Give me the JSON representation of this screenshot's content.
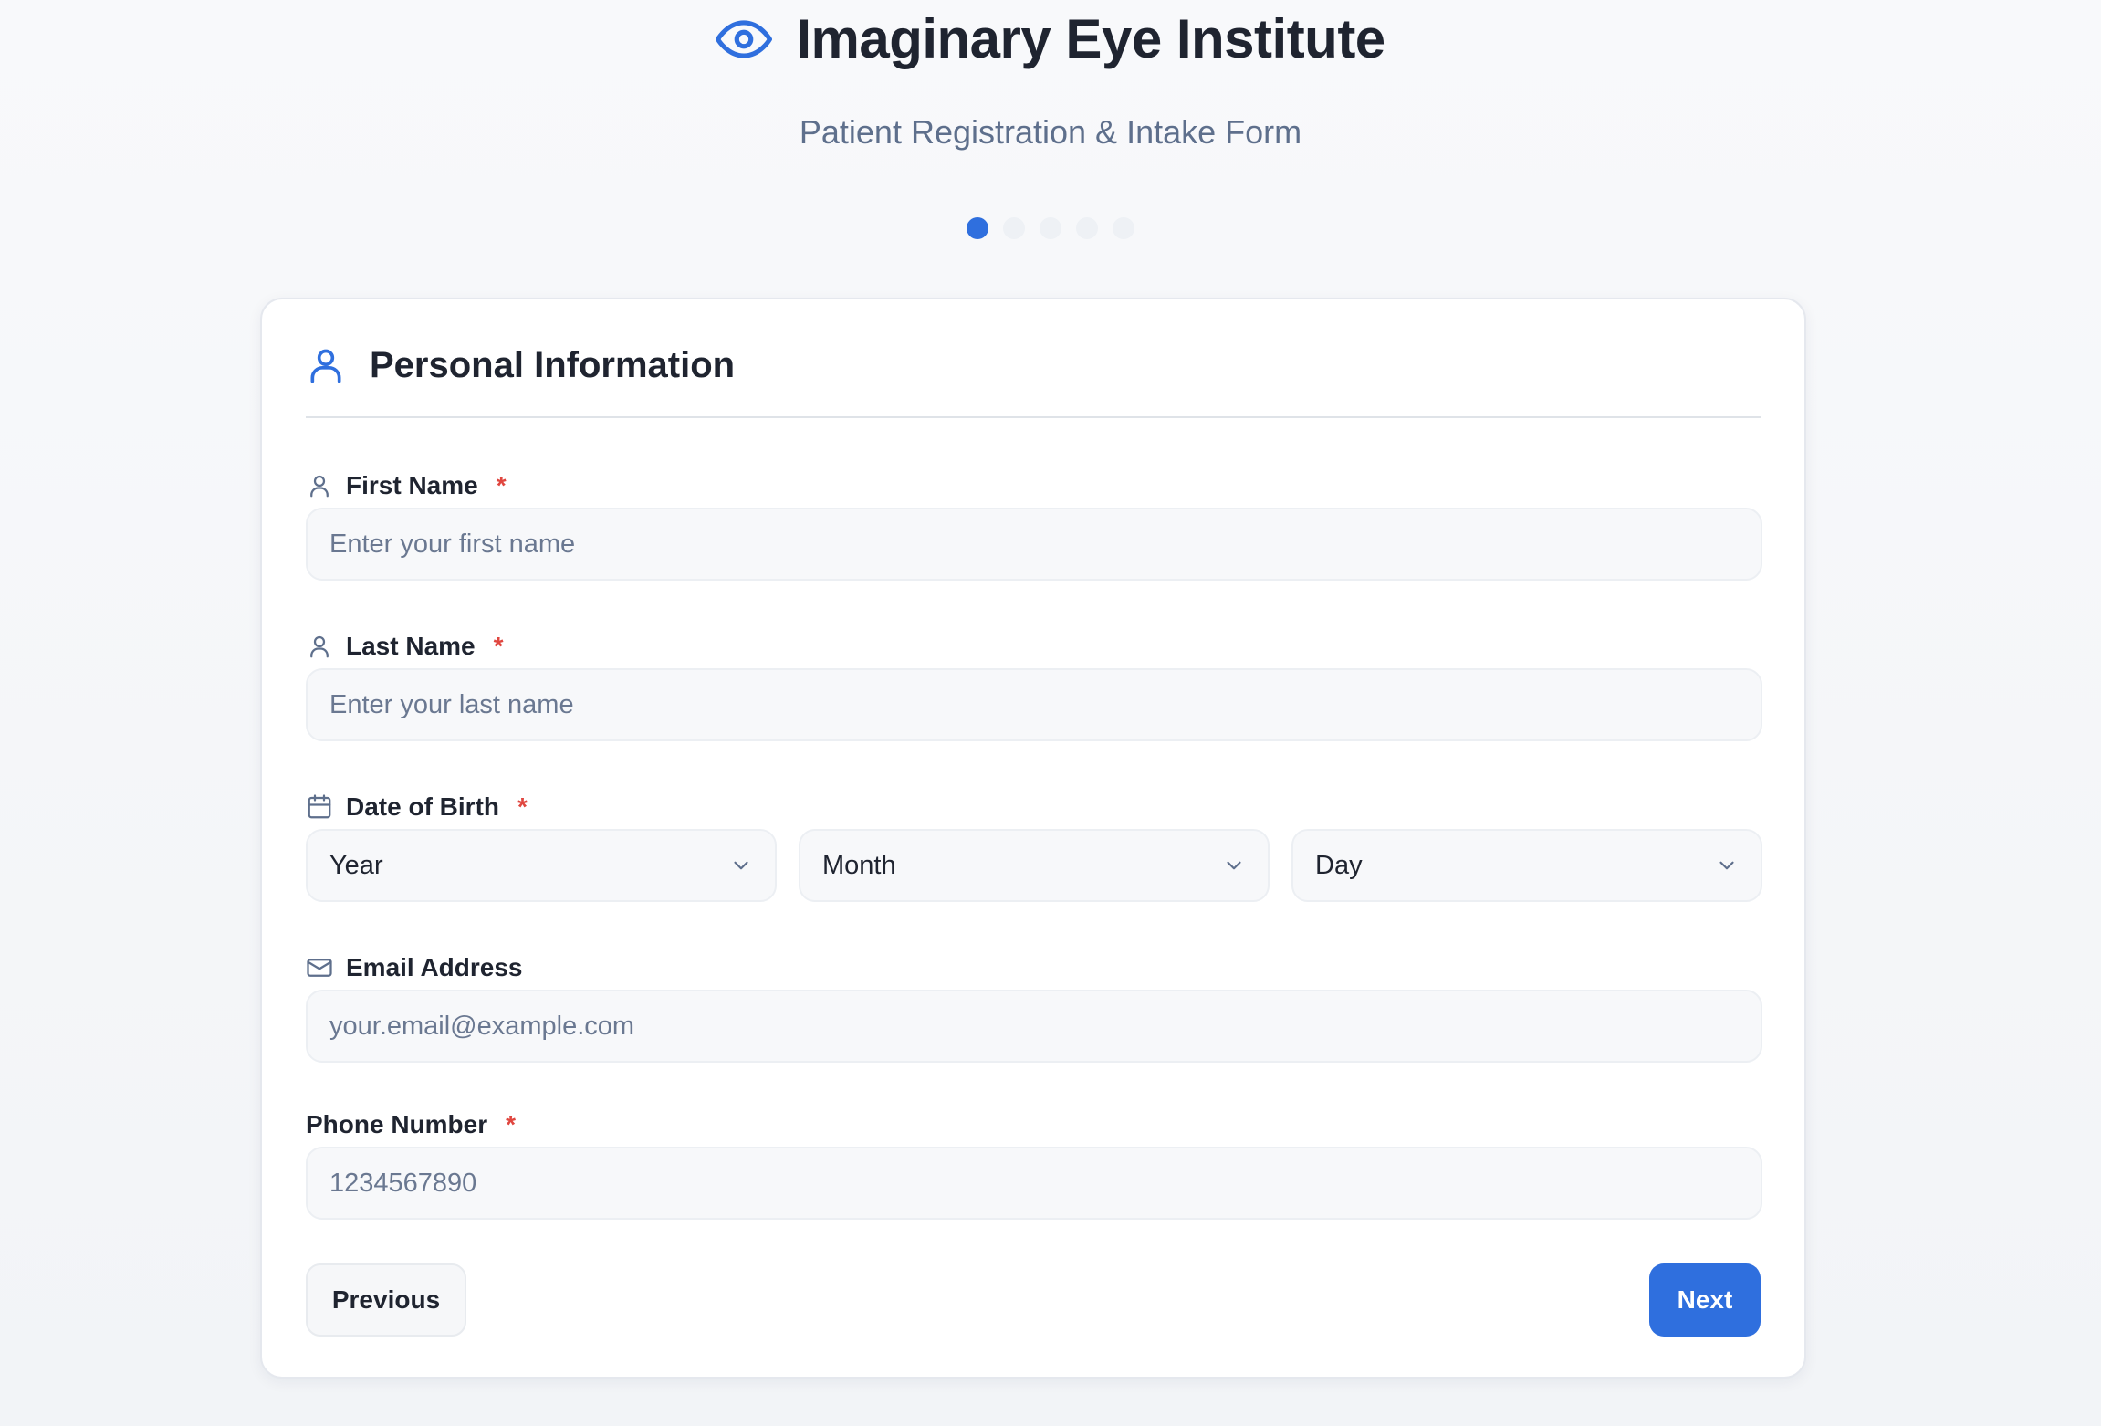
{
  "header": {
    "title": "Imaginary Eye Institute",
    "subtitle": "Patient Registration & Intake Form",
    "logo_icon": "eye-icon",
    "steps_total": 5,
    "step_current": 1
  },
  "card": {
    "title": "Personal Information",
    "icon": "user-icon",
    "fields": {
      "first_name": {
        "label": "First Name",
        "required_mark": "*",
        "placeholder": "Enter your first name",
        "icon": "user-icon"
      },
      "last_name": {
        "label": "Last Name",
        "required_mark": "*",
        "placeholder": "Enter your last name",
        "icon": "user-icon"
      },
      "dob": {
        "label": "Date of Birth",
        "required_mark": "*",
        "icon": "calendar-icon",
        "year": "Year",
        "month": "Month",
        "day": "Day"
      },
      "email": {
        "label": "Email Address",
        "placeholder": "your.email@example.com",
        "icon": "mail-icon"
      },
      "phone": {
        "label": "Phone Number",
        "required_mark": "*",
        "placeholder": "1234567890"
      }
    }
  },
  "buttons": {
    "previous": "Previous",
    "next": "Next"
  },
  "colors": {
    "accent": "#2f6fde",
    "required": "#e0463f",
    "muted_text": "#5e6f8c"
  }
}
